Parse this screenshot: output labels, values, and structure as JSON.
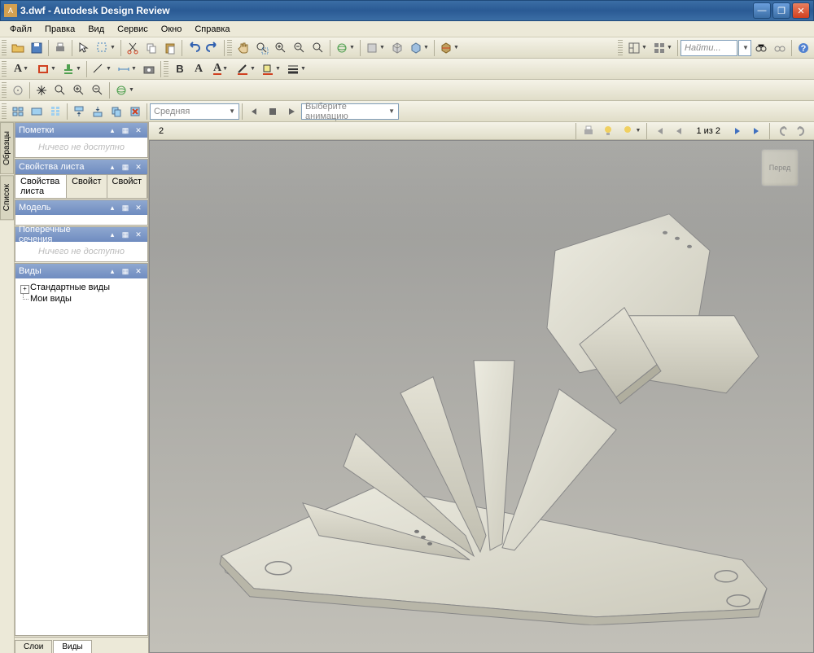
{
  "title": "3.dwf - Autodesk Design Review",
  "menus": [
    "Файл",
    "Правка",
    "Вид",
    "Сервис",
    "Окно",
    "Справка"
  ],
  "menu_accel": [
    "Ф",
    "П",
    "В",
    "С",
    "О",
    "С"
  ],
  "search": {
    "placeholder": "Найти..."
  },
  "combo_quality": "Средняя",
  "combo_anim": "Выберите анимацию",
  "sidebar_tabs": [
    "Образцы",
    "Список"
  ],
  "panels": {
    "notes": {
      "title": "Пометки",
      "empty": "Ничего не доступно"
    },
    "sheet": {
      "title": "Свойства листа",
      "tabs": [
        "Свойства листа",
        "Свойст",
        "Свойст"
      ]
    },
    "model": {
      "title": "Модель"
    },
    "sections": {
      "title": "Поперечные сечения",
      "empty": "Ничего не доступно"
    },
    "views": {
      "title": "Виды",
      "items": [
        "Стандартные виды",
        "Мои виды"
      ]
    }
  },
  "bottom_tabs": [
    "Слои",
    "Виды"
  ],
  "viewport": {
    "page_label": "2",
    "page_counter": "1 из 2",
    "viewcube": "Перед"
  }
}
